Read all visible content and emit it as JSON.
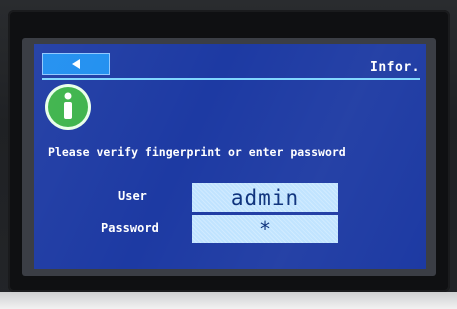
{
  "header": {
    "title": "Infor.",
    "back_icon": "back-arrow-icon"
  },
  "info_icon": "info-icon",
  "message": "Please verify fingerprint or enter password",
  "form": {
    "user_label": "User",
    "user_value": "admin",
    "password_label": "Password",
    "password_value": "*"
  },
  "colors": {
    "screen_bg": "#1d3aa3",
    "accent_button": "#1e8ef0",
    "divider": "#7fd6ff",
    "field_bg": "#bfe3ff",
    "icon_green": "#3cb34a"
  }
}
